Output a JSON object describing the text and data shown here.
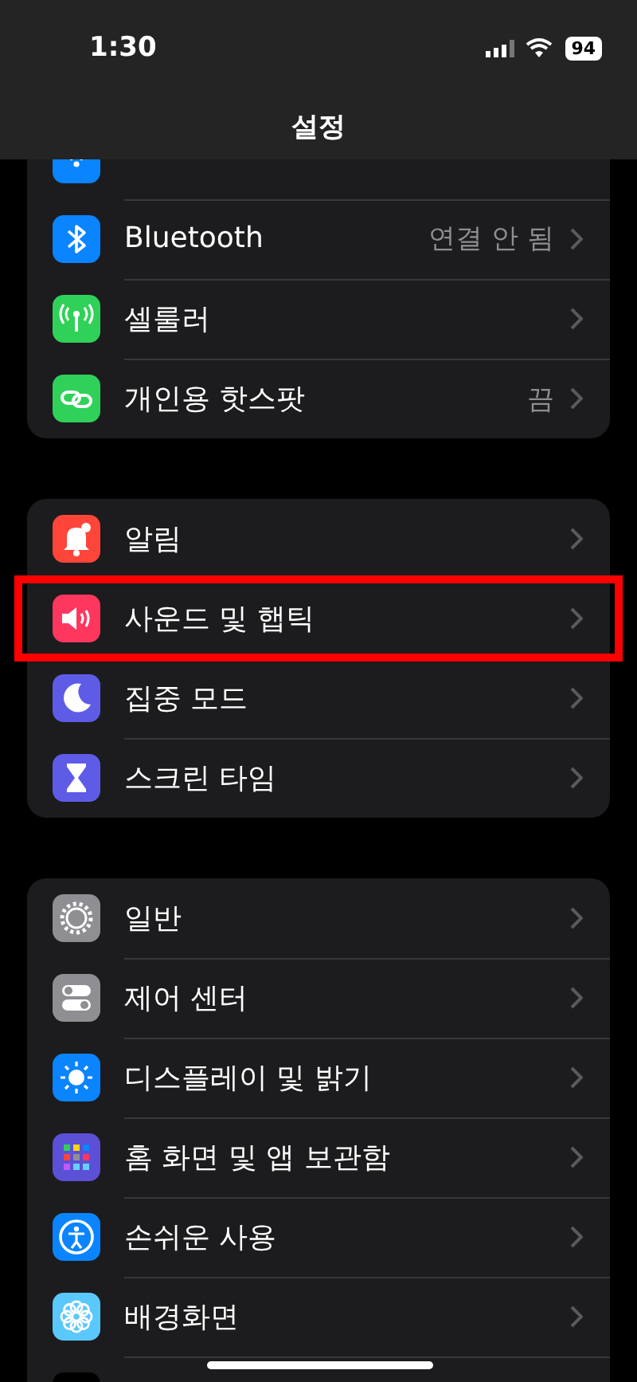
{
  "status_bar": {
    "time": "1:30",
    "battery": "94"
  },
  "header": {
    "title": "설정"
  },
  "sections": [
    {
      "items": [
        {
          "color": "#0a84ff",
          "highlighted": false
        },
        {
          "label": "Bluetooth",
          "value": "연결 안 됨",
          "color": "#0a84ff",
          "highlighted": false
        },
        {
          "label": "셀룰러",
          "color": "#30d158",
          "highlighted": false
        },
        {
          "label": "개인용 핫스팟",
          "value": "끔",
          "color": "#30d158",
          "highlighted": false
        }
      ]
    },
    {
      "items": [
        {
          "label": "알림",
          "color": "#ff453a",
          "highlighted": false
        },
        {
          "label": "사운드 및 햅틱",
          "color": "#ff375f",
          "highlighted": true
        },
        {
          "label": "집중 모드",
          "color": "#5e5ce6",
          "highlighted": false
        },
        {
          "label": "스크린 타임",
          "color": "#5e5ce6",
          "highlighted": false
        }
      ]
    },
    {
      "items": [
        {
          "label": "일반",
          "color": "#8e8e93",
          "highlighted": false
        },
        {
          "label": "제어 센터",
          "color": "#8e8e93",
          "highlighted": false
        },
        {
          "label": "디스플레이 및 밝기",
          "color": "#0a84ff",
          "highlighted": false
        },
        {
          "label": "홈 화면 및 앱 보관함",
          "color": "#5b50d6",
          "highlighted": false
        },
        {
          "label": "손쉬운 사용",
          "color": "#0a84ff",
          "highlighted": false
        },
        {
          "label": "배경화면",
          "color": "#5ac8fa",
          "highlighted": false
        },
        {
          "color": "#000000",
          "highlighted": false
        }
      ]
    }
  ]
}
